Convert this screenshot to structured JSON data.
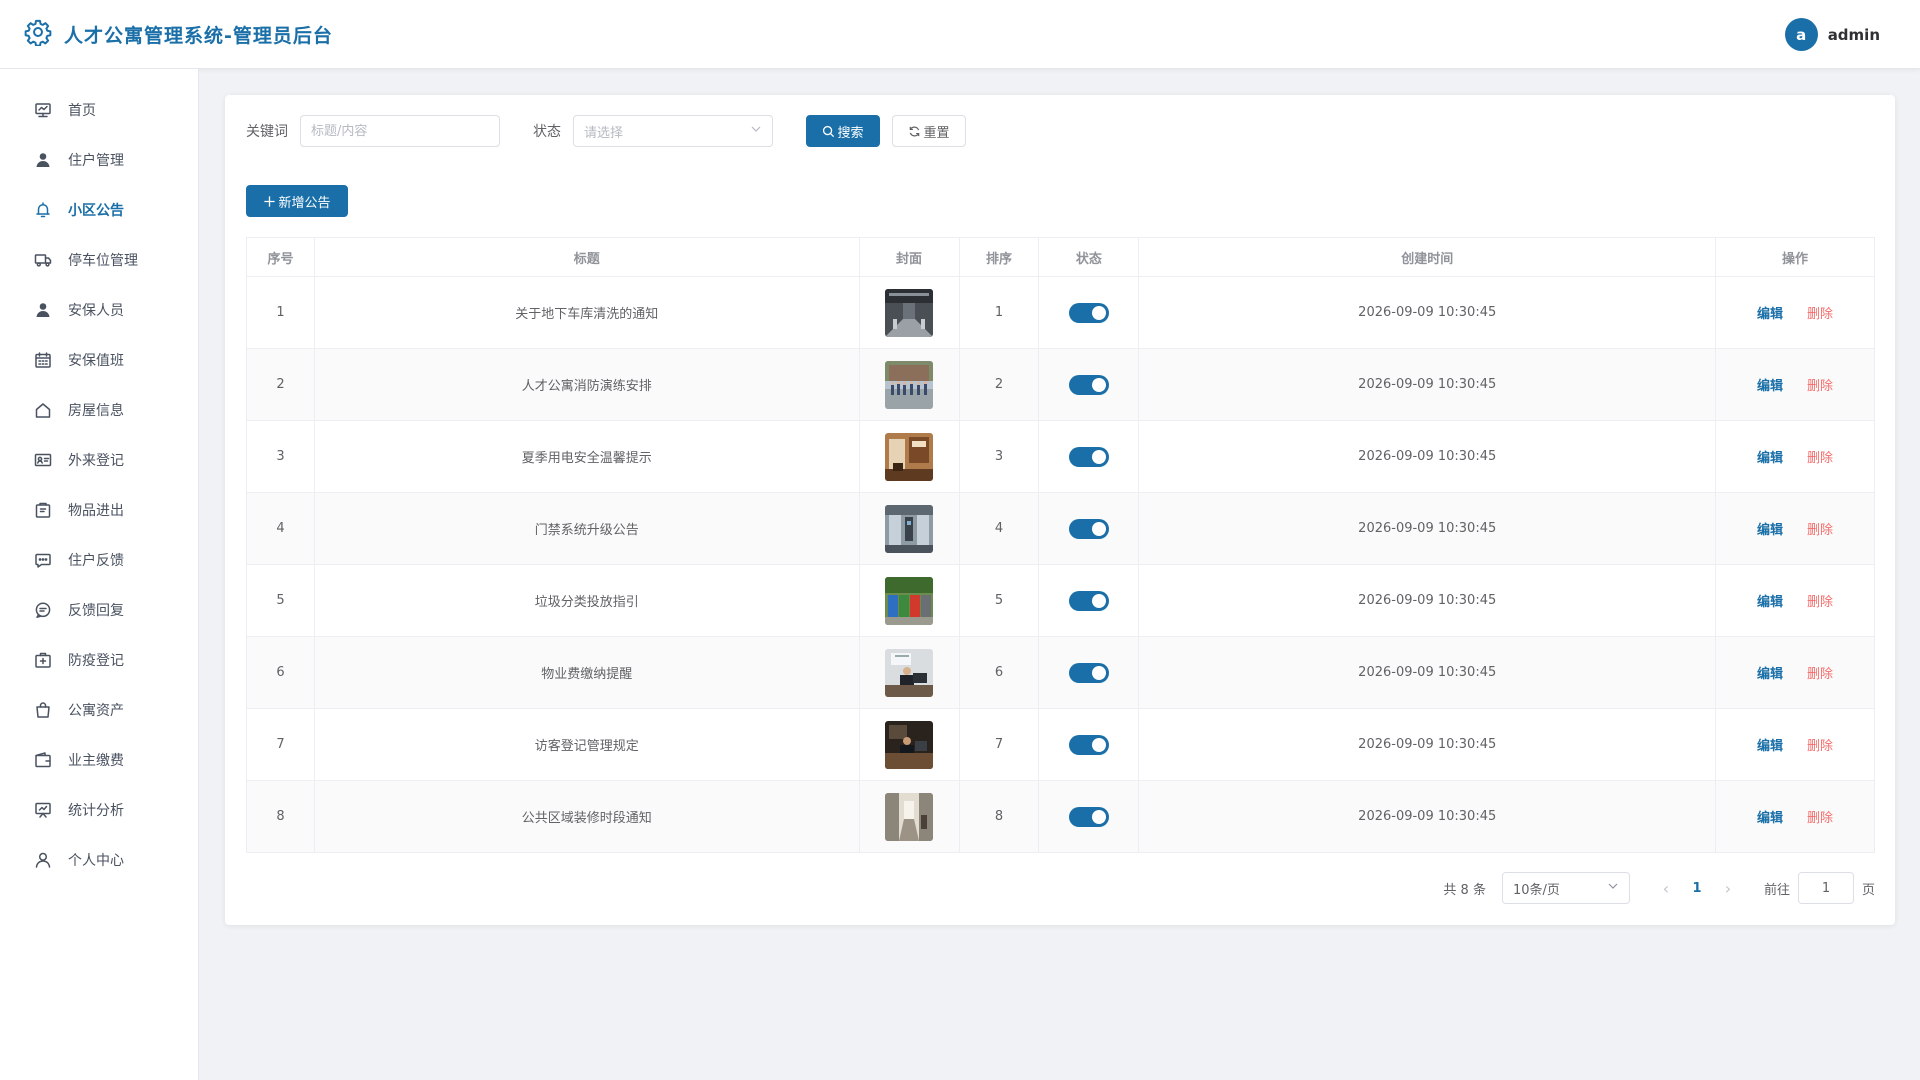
{
  "app": {
    "title": "人才公寓管理系统-管理员后台"
  },
  "user": {
    "avatar_letter": "a",
    "name": "admin"
  },
  "colors": {
    "primary": "#1a6fa8",
    "danger": "#f56c6c",
    "background": "#f0f2f5"
  },
  "sidebar": {
    "items": [
      {
        "label": "首页",
        "icon": "monitor-icon",
        "active": false
      },
      {
        "label": "住户管理",
        "icon": "user-filled-icon",
        "active": false
      },
      {
        "label": "小区公告",
        "icon": "bell-icon",
        "active": true
      },
      {
        "label": "停车位管理",
        "icon": "truck-icon",
        "active": false
      },
      {
        "label": "安保人员",
        "icon": "user-filled-icon",
        "active": false
      },
      {
        "label": "安保值班",
        "icon": "calendar-icon",
        "active": false
      },
      {
        "label": "房屋信息",
        "icon": "house-icon",
        "active": false
      },
      {
        "label": "外来登记",
        "icon": "id-card-icon",
        "active": false
      },
      {
        "label": "物品进出",
        "icon": "box-icon",
        "active": false
      },
      {
        "label": "住户反馈",
        "icon": "chat-dots-icon",
        "active": false
      },
      {
        "label": "反馈回复",
        "icon": "chat-lines-icon",
        "active": false
      },
      {
        "label": "防疫登记",
        "icon": "first-aid-icon",
        "active": false
      },
      {
        "label": "公寓资产",
        "icon": "shopping-bag-icon",
        "active": false
      },
      {
        "label": "业主缴费",
        "icon": "wallet-icon",
        "active": false
      },
      {
        "label": "统计分析",
        "icon": "data-board-icon",
        "active": false
      },
      {
        "label": "个人中心",
        "icon": "user-outline-icon",
        "active": false
      }
    ]
  },
  "filter": {
    "keyword_label": "关键词",
    "keyword_placeholder": "标题/内容",
    "keyword_value": "",
    "status_label": "状态",
    "status_placeholder": "请选择",
    "search_label": "搜索",
    "reset_label": "重置"
  },
  "toolbar": {
    "add_label": "新增公告"
  },
  "table": {
    "columns": [
      "序号",
      "标题",
      "封面",
      "排序",
      "状态",
      "创建时间",
      "操作"
    ],
    "edit_label": "编辑",
    "delete_label": "删除",
    "rows": [
      {
        "index": "1",
        "title": "关于地下车库清洗的通知",
        "cover": "garage-photo",
        "sort": "1",
        "enabled": true,
        "created": "2026-09-09 10:30:45"
      },
      {
        "index": "2",
        "title": "人才公寓消防演练安排",
        "cover": "fire-drill-photo",
        "sort": "2",
        "enabled": true,
        "created": "2026-09-09 10:30:45"
      },
      {
        "index": "3",
        "title": "夏季用电安全温馨提示",
        "cover": "interior-photo",
        "sort": "3",
        "enabled": true,
        "created": "2026-09-09 10:30:45"
      },
      {
        "index": "4",
        "title": "门禁系统升级公告",
        "cover": "gate-photo",
        "sort": "4",
        "enabled": true,
        "created": "2026-09-09 10:30:45"
      },
      {
        "index": "5",
        "title": "垃圾分类投放指引",
        "cover": "bins-photo",
        "sort": "5",
        "enabled": true,
        "created": "2026-09-09 10:30:45"
      },
      {
        "index": "6",
        "title": "物业费缴纳提醒",
        "cover": "office-photo",
        "sort": "6",
        "enabled": true,
        "created": "2026-09-09 10:30:45"
      },
      {
        "index": "7",
        "title": "访客登记管理规定",
        "cover": "reception-photo",
        "sort": "7",
        "enabled": true,
        "created": "2026-09-09 10:30:45"
      },
      {
        "index": "8",
        "title": "公共区域装修时段通知",
        "cover": "hallway-photo",
        "sort": "8",
        "enabled": true,
        "created": "2026-09-09 10:30:45"
      }
    ]
  },
  "pagination": {
    "total_text": "共 8 条",
    "page_size": "10条/页",
    "current_page": "1",
    "goto_label": "前往",
    "goto_value": "1",
    "page_suffix": "页"
  }
}
